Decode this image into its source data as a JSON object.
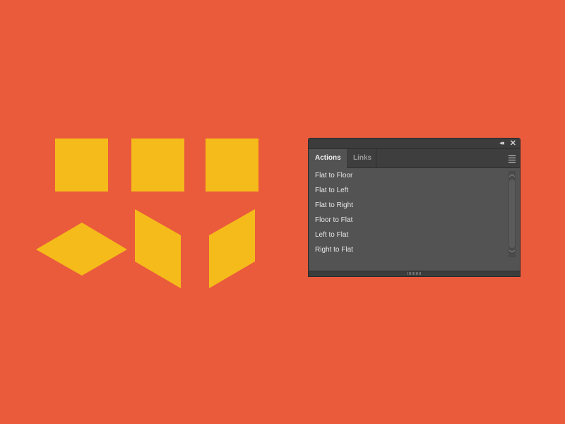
{
  "canvas": {
    "background_color": "#EA5B3C",
    "shape_color": "#F5BB1A",
    "shapes": [
      {
        "name": "square-1",
        "type": "square"
      },
      {
        "name": "square-2",
        "type": "square"
      },
      {
        "name": "square-3",
        "type": "square"
      },
      {
        "name": "floor-diamond",
        "type": "rhombus"
      },
      {
        "name": "left-face-parallelogram",
        "type": "parallelogram"
      },
      {
        "name": "right-face-parallelogram",
        "type": "parallelogram"
      }
    ]
  },
  "panel": {
    "collapse_icon": "double-chevron-left",
    "close_icon": "close-x",
    "tabs": [
      {
        "label": "Actions",
        "active": true
      },
      {
        "label": "Links",
        "active": false
      }
    ],
    "menu_icon": "hamburger-menu",
    "actions": [
      {
        "label": "Flat to Floor"
      },
      {
        "label": "Flat to Left"
      },
      {
        "label": "Flat to Right"
      },
      {
        "label": "Floor to Flat"
      },
      {
        "label": "Left to Flat"
      },
      {
        "label": "Right to Flat"
      }
    ]
  }
}
